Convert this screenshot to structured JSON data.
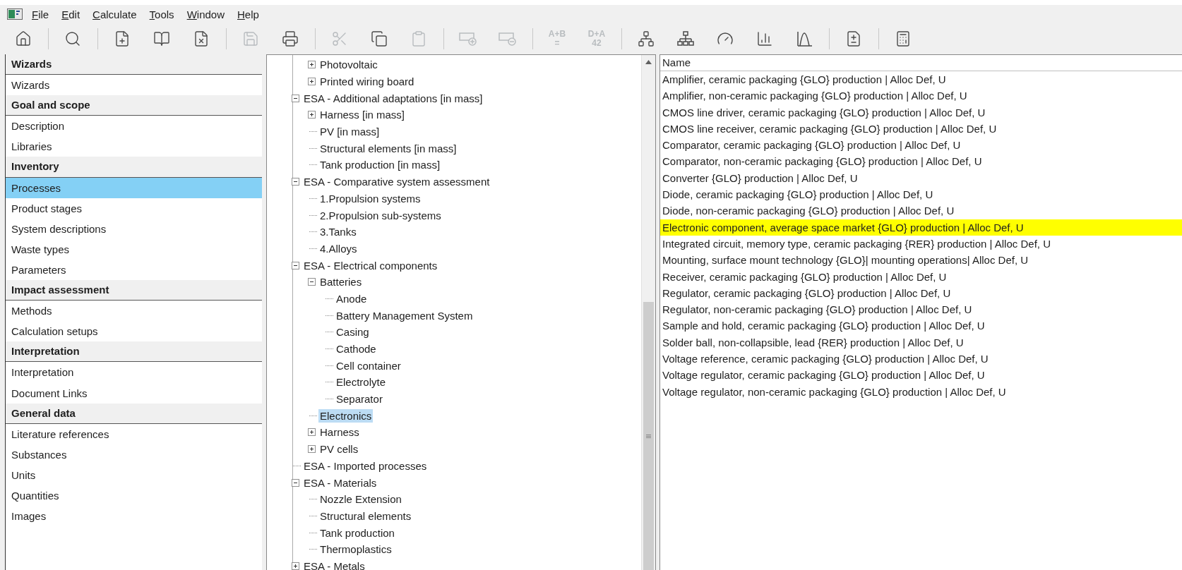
{
  "menu": [
    "File",
    "Edit",
    "Calculate",
    "Tools",
    "Window",
    "Help"
  ],
  "toolbar": [
    [
      {
        "disabled": false
      }
    ],
    [
      {
        "disabled": false
      }
    ],
    [
      {
        "disabled": false
      },
      {
        "disabled": false
      },
      {
        "disabled": false
      }
    ],
    [
      {
        "disabled": true
      },
      {
        "disabled": false
      }
    ],
    [
      {
        "disabled": true
      },
      {
        "disabled": false
      },
      {
        "disabled": true
      }
    ],
    [
      {
        "disabled": true
      },
      {
        "disabled": true
      }
    ],
    [
      {
        "disabled": true,
        "label": "A+B",
        "sub": "="
      },
      {
        "disabled": true,
        "label": "D+A",
        "sub": "42"
      }
    ],
    [
      {
        "disabled": false
      },
      {
        "disabled": false
      },
      {
        "disabled": false
      },
      {
        "disabled": false
      },
      {
        "disabled": false
      }
    ],
    [
      {
        "disabled": false
      }
    ],
    [
      {
        "disabled": false
      }
    ]
  ],
  "sidebar": [
    {
      "title": "Wizards",
      "items": [
        {
          "label": "Wizards",
          "selected": false
        }
      ]
    },
    {
      "title": "Goal and scope",
      "items": [
        {
          "label": "Description",
          "selected": false
        },
        {
          "label": "Libraries",
          "selected": false
        }
      ]
    },
    {
      "title": "Inventory",
      "items": [
        {
          "label": "Processes",
          "selected": true
        },
        {
          "label": "Product stages",
          "selected": false
        },
        {
          "label": "System descriptions",
          "selected": false
        },
        {
          "label": "Waste types",
          "selected": false
        },
        {
          "label": "Parameters",
          "selected": false
        }
      ]
    },
    {
      "title": "Impact assessment",
      "items": [
        {
          "label": "Methods",
          "selected": false
        },
        {
          "label": "Calculation setups",
          "selected": false
        }
      ]
    },
    {
      "title": "Interpretation",
      "items": [
        {
          "label": "Interpretation",
          "selected": false
        },
        {
          "label": "Document Links",
          "selected": false
        }
      ]
    },
    {
      "title": "General data",
      "items": [
        {
          "label": "Literature references",
          "selected": false
        },
        {
          "label": "Substances",
          "selected": false
        },
        {
          "label": "Units",
          "selected": false
        },
        {
          "label": "Quantities",
          "selected": false
        },
        {
          "label": "Images",
          "selected": false
        }
      ]
    }
  ],
  "tree": {
    "items": [
      {
        "children": [
          {
            "label": "Photovoltaic",
            "expanded": false,
            "selected": false
          },
          {
            "label": "Printed wiring board",
            "expanded": false,
            "selected": false
          }
        ]
      },
      {
        "label": "ESA - Additional adaptations [in mass]",
        "expanded": true,
        "selected": false,
        "children": [
          {
            "label": "Harness [in mass]",
            "expanded": false,
            "selected": false
          },
          {
            "label": "PV [in mass]",
            "selected": false
          },
          {
            "label": "Structural elements [in mass]",
            "selected": false
          },
          {
            "label": "Tank production [in mass]",
            "selected": false
          }
        ]
      },
      {
        "label": "ESA - Comparative system assessment",
        "expanded": true,
        "selected": false,
        "children": [
          {
            "label": "1.Propulsion systems",
            "selected": false
          },
          {
            "label": "2.Propulsion sub-systems",
            "selected": false
          },
          {
            "label": "3.Tanks",
            "selected": false
          },
          {
            "label": "4.Alloys",
            "selected": false
          }
        ]
      },
      {
        "label": "ESA - Electrical components",
        "expanded": true,
        "selected": false,
        "children": [
          {
            "label": "Batteries",
            "expanded": true,
            "selected": false,
            "children": [
              {
                "label": "Anode",
                "selected": false
              },
              {
                "label": "Battery Management System",
                "selected": false
              },
              {
                "label": "Casing",
                "selected": false
              },
              {
                "label": "Cathode",
                "selected": false
              },
              {
                "label": "Cell container",
                "selected": false
              },
              {
                "label": "Electrolyte",
                "selected": false
              },
              {
                "label": "Separator",
                "selected": false
              }
            ]
          },
          {
            "label": "Electronics",
            "selected": true
          },
          {
            "label": "Harness",
            "expanded": false,
            "selected": false
          },
          {
            "label": "PV cells",
            "expanded": false,
            "selected": false
          }
        ]
      },
      {
        "label": "ESA - Imported processes",
        "selected": false
      },
      {
        "label": "ESA - Materials",
        "expanded": true,
        "selected": false,
        "children": [
          {
            "label": "Nozzle Extension",
            "selected": false
          },
          {
            "label": "Structural elements",
            "selected": false
          },
          {
            "label": "Tank production",
            "selected": false
          },
          {
            "label": "Thermoplastics",
            "selected": false
          }
        ]
      },
      {
        "label": "ESA - Metals",
        "expanded": false,
        "selected": false
      }
    ]
  },
  "list": {
    "column": "Name",
    "rows": [
      {
        "name": "Amplifier, ceramic packaging {GLO} production | Alloc Def, U",
        "selected": false
      },
      {
        "name": "Amplifier, non-ceramic packaging {GLO} production | Alloc Def, U",
        "selected": false
      },
      {
        "name": "CMOS line driver, ceramic packaging {GLO} production | Alloc Def, U",
        "selected": false
      },
      {
        "name": "CMOS line receiver, ceramic packaging {GLO} production | Alloc Def, U",
        "selected": false
      },
      {
        "name": "Comparator, ceramic packaging {GLO} production | Alloc Def, U",
        "selected": false
      },
      {
        "name": "Comparator, non-ceramic packaging {GLO} production | Alloc Def, U",
        "selected": false
      },
      {
        "name": "Converter {GLO} production | Alloc Def, U",
        "selected": false
      },
      {
        "name": "Diode, ceramic packaging {GLO} production | Alloc Def, U",
        "selected": false
      },
      {
        "name": "Diode, non-ceramic packaging {GLO} production | Alloc Def, U",
        "selected": false
      },
      {
        "name": "Electronic component, average space market {GLO} production | Alloc Def, U",
        "selected": true
      },
      {
        "name": "Integrated circuit, memory type, ceramic packaging {RER} production | Alloc Def, U",
        "selected": false
      },
      {
        "name": "Mounting, surface mount technology {GLO}| mounting operations| Alloc Def, U",
        "selected": false
      },
      {
        "name": "Receiver, ceramic packaging {GLO} production | Alloc Def, U",
        "selected": false
      },
      {
        "name": "Regulator, ceramic packaging {GLO} production | Alloc Def, U",
        "selected": false
      },
      {
        "name": "Regulator, non-ceramic packaging {GLO} production | Alloc Def, U",
        "selected": false
      },
      {
        "name": "Sample and hold, ceramic packaging {GLO} production | Alloc Def, U",
        "selected": false
      },
      {
        "name": "Solder ball, non-collapsible, lead {RER} production | Alloc Def, U",
        "selected": false
      },
      {
        "name": "Voltage reference, ceramic packaging {GLO} production | Alloc Def, U",
        "selected": false
      },
      {
        "name": "Voltage regulator, ceramic packaging {GLO} production | Alloc Def, U",
        "selected": false
      },
      {
        "name": "Voltage regulator, non-ceramic packaging {GLO} production | Alloc Def, U",
        "selected": false
      }
    ]
  }
}
